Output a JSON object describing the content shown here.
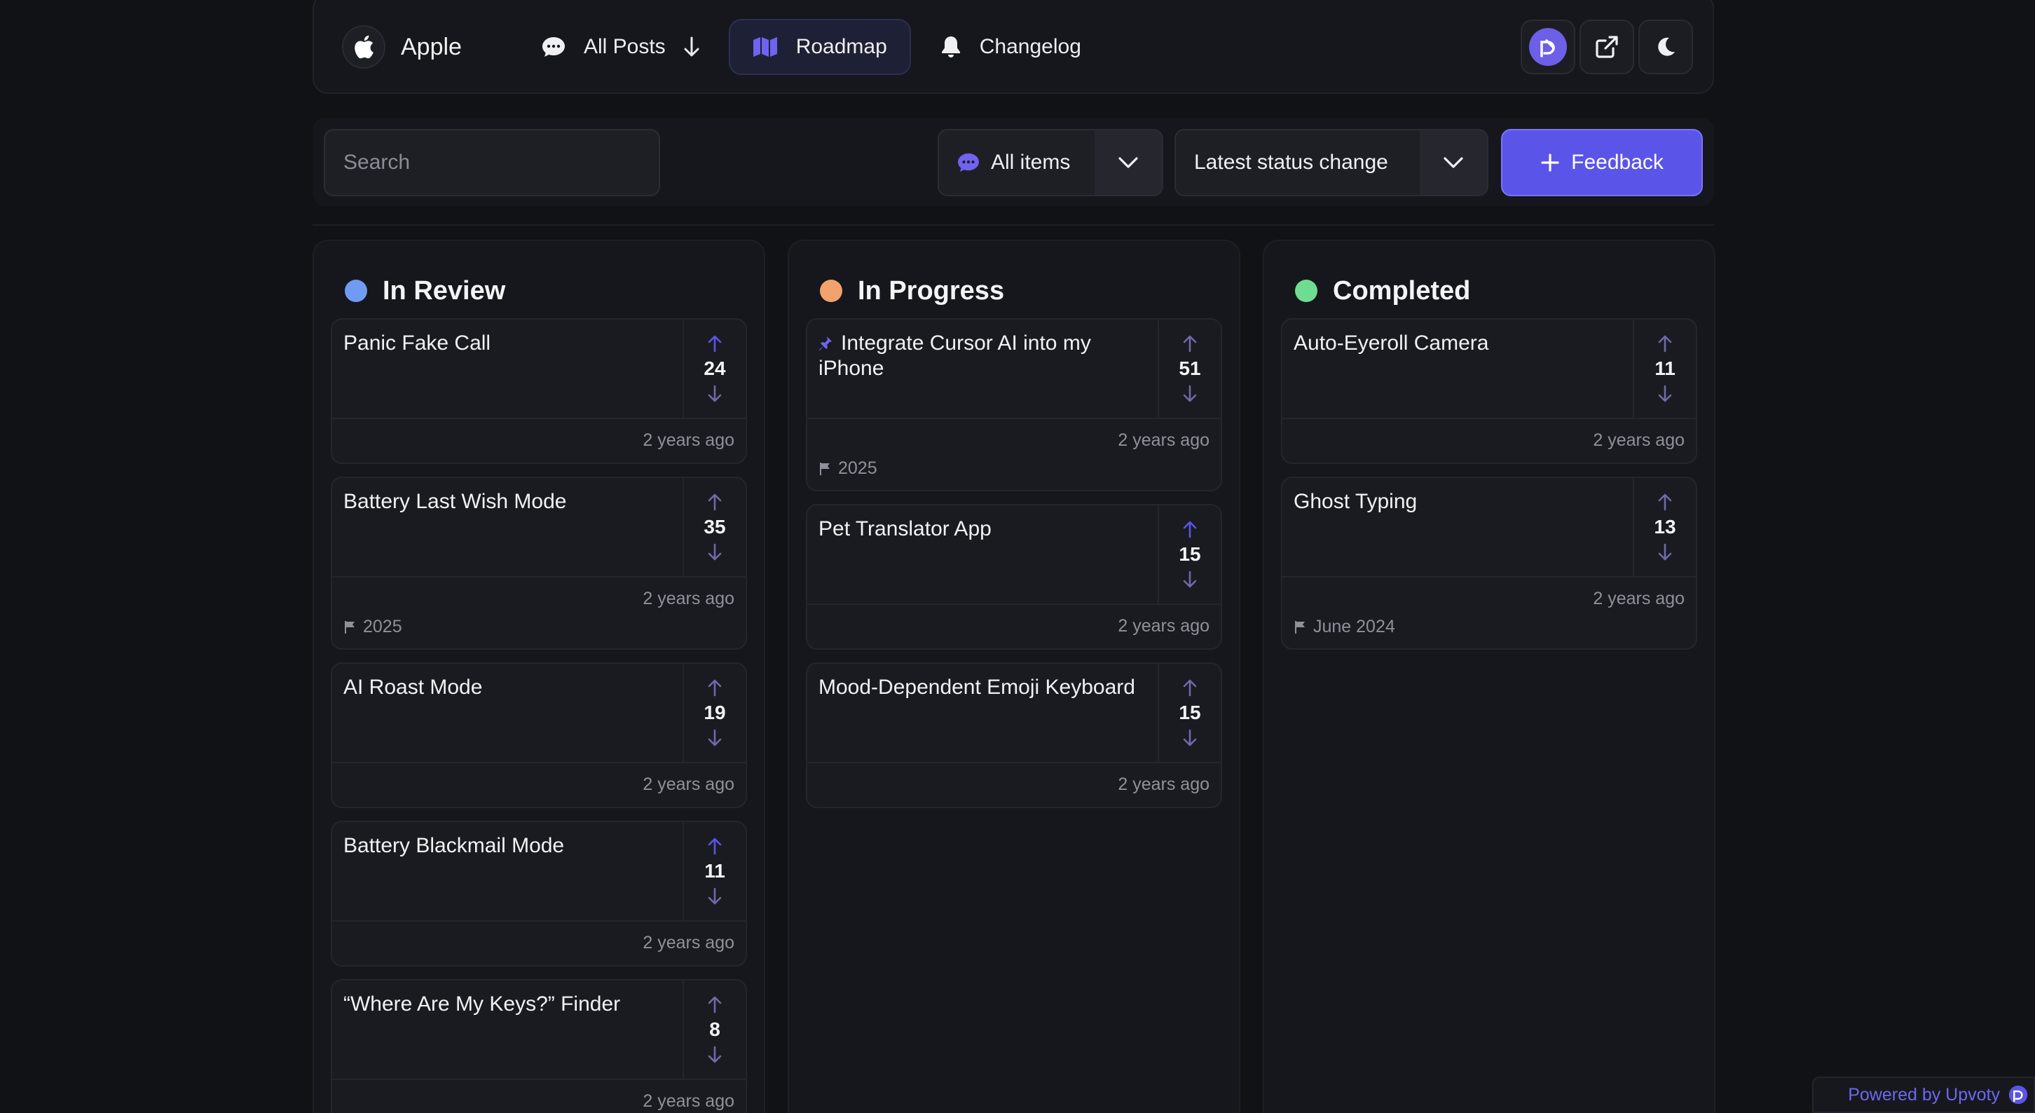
{
  "nav": {
    "brand": "Apple",
    "all_posts": "All Posts",
    "roadmap": "Roadmap",
    "changelog": "Changelog"
  },
  "filters": {
    "search_placeholder": "Search",
    "items_select": "All items",
    "sort_select": "Latest status change",
    "feedback_button": "Feedback"
  },
  "colors": {
    "in_review": "#6f9cf2",
    "in_progress": "#f2a26c",
    "completed": "#6fdc92",
    "accent": "#5b54e8"
  },
  "columns": [
    {
      "title": "In Review",
      "cards": [
        {
          "title": "Panic Fake Call",
          "votes": "24",
          "time": "2 years ago",
          "tag": "",
          "upvoted": true
        },
        {
          "title": "Battery Last Wish Mode",
          "votes": "35",
          "time": "2 years ago",
          "tag": "2025",
          "upvoted": false
        },
        {
          "title": "AI Roast Mode",
          "votes": "19",
          "time": "2 years ago",
          "tag": "",
          "upvoted": false
        },
        {
          "title": "Battery Blackmail Mode",
          "votes": "11",
          "time": "2 years ago",
          "tag": "",
          "upvoted": true
        },
        {
          "title": "“Where Are My Keys?” Finder",
          "votes": "8",
          "time": "2 years ago",
          "tag": "",
          "upvoted": false
        }
      ]
    },
    {
      "title": "In Progress",
      "cards": [
        {
          "title": "Integrate Cursor AI into my iPhone",
          "votes": "51",
          "time": "2 years ago",
          "tag": "2025",
          "pinned": true,
          "upvoted": false
        },
        {
          "title": "Pet Translator App",
          "votes": "15",
          "time": "2 years ago",
          "tag": "",
          "upvoted": true
        },
        {
          "title": "Mood-Dependent Emoji Keyboard",
          "votes": "15",
          "time": "2 years ago",
          "tag": "",
          "upvoted": false
        }
      ]
    },
    {
      "title": "Completed",
      "cards": [
        {
          "title": "Auto-Eyeroll Camera",
          "votes": "11",
          "time": "2 years ago",
          "tag": "",
          "upvoted": false
        },
        {
          "title": "Ghost Typing",
          "votes": "13",
          "time": "2 years ago",
          "tag": "June 2024",
          "upvoted": false
        }
      ]
    }
  ],
  "footer": {
    "powered_by": "Powered by Upvoty"
  },
  "icons": {
    "brand": "apple-icon",
    "all_posts": "chat-bubble-icon",
    "sort": "arrow-down-icon",
    "roadmap": "map-icon",
    "changelog": "bell-icon",
    "profile": "upvoty-avatar-icon",
    "external": "external-link-icon",
    "theme": "moon-icon",
    "flag": "flag-icon",
    "pin": "pin-icon"
  }
}
